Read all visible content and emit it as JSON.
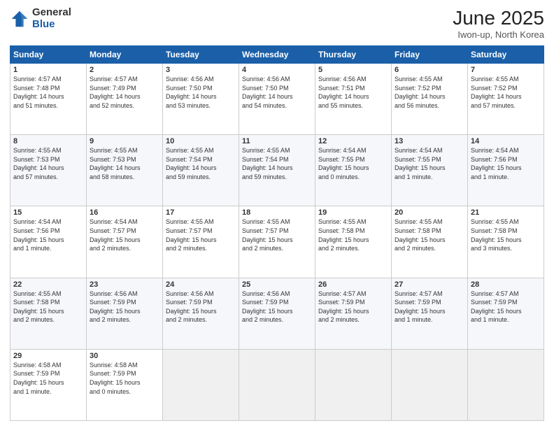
{
  "logo": {
    "general": "General",
    "blue": "Blue"
  },
  "title": {
    "month": "June 2025",
    "location": "Iwon-up, North Korea"
  },
  "weekdays": [
    "Sunday",
    "Monday",
    "Tuesday",
    "Wednesday",
    "Thursday",
    "Friday",
    "Saturday"
  ],
  "weeks": [
    [
      {
        "day": "1",
        "info": "Sunrise: 4:57 AM\nSunset: 7:48 PM\nDaylight: 14 hours\nand 51 minutes."
      },
      {
        "day": "2",
        "info": "Sunrise: 4:57 AM\nSunset: 7:49 PM\nDaylight: 14 hours\nand 52 minutes."
      },
      {
        "day": "3",
        "info": "Sunrise: 4:56 AM\nSunset: 7:50 PM\nDaylight: 14 hours\nand 53 minutes."
      },
      {
        "day": "4",
        "info": "Sunrise: 4:56 AM\nSunset: 7:50 PM\nDaylight: 14 hours\nand 54 minutes."
      },
      {
        "day": "5",
        "info": "Sunrise: 4:56 AM\nSunset: 7:51 PM\nDaylight: 14 hours\nand 55 minutes."
      },
      {
        "day": "6",
        "info": "Sunrise: 4:55 AM\nSunset: 7:52 PM\nDaylight: 14 hours\nand 56 minutes."
      },
      {
        "day": "7",
        "info": "Sunrise: 4:55 AM\nSunset: 7:52 PM\nDaylight: 14 hours\nand 57 minutes."
      }
    ],
    [
      {
        "day": "8",
        "info": "Sunrise: 4:55 AM\nSunset: 7:53 PM\nDaylight: 14 hours\nand 57 minutes."
      },
      {
        "day": "9",
        "info": "Sunrise: 4:55 AM\nSunset: 7:53 PM\nDaylight: 14 hours\nand 58 minutes."
      },
      {
        "day": "10",
        "info": "Sunrise: 4:55 AM\nSunset: 7:54 PM\nDaylight: 14 hours\nand 59 minutes."
      },
      {
        "day": "11",
        "info": "Sunrise: 4:55 AM\nSunset: 7:54 PM\nDaylight: 14 hours\nand 59 minutes."
      },
      {
        "day": "12",
        "info": "Sunrise: 4:54 AM\nSunset: 7:55 PM\nDaylight: 15 hours\nand 0 minutes."
      },
      {
        "day": "13",
        "info": "Sunrise: 4:54 AM\nSunset: 7:55 PM\nDaylight: 15 hours\nand 1 minute."
      },
      {
        "day": "14",
        "info": "Sunrise: 4:54 AM\nSunset: 7:56 PM\nDaylight: 15 hours\nand 1 minute."
      }
    ],
    [
      {
        "day": "15",
        "info": "Sunrise: 4:54 AM\nSunset: 7:56 PM\nDaylight: 15 hours\nand 1 minute."
      },
      {
        "day": "16",
        "info": "Sunrise: 4:54 AM\nSunset: 7:57 PM\nDaylight: 15 hours\nand 2 minutes."
      },
      {
        "day": "17",
        "info": "Sunrise: 4:55 AM\nSunset: 7:57 PM\nDaylight: 15 hours\nand 2 minutes."
      },
      {
        "day": "18",
        "info": "Sunrise: 4:55 AM\nSunset: 7:57 PM\nDaylight: 15 hours\nand 2 minutes."
      },
      {
        "day": "19",
        "info": "Sunrise: 4:55 AM\nSunset: 7:58 PM\nDaylight: 15 hours\nand 2 minutes."
      },
      {
        "day": "20",
        "info": "Sunrise: 4:55 AM\nSunset: 7:58 PM\nDaylight: 15 hours\nand 2 minutes."
      },
      {
        "day": "21",
        "info": "Sunrise: 4:55 AM\nSunset: 7:58 PM\nDaylight: 15 hours\nand 3 minutes."
      }
    ],
    [
      {
        "day": "22",
        "info": "Sunrise: 4:55 AM\nSunset: 7:58 PM\nDaylight: 15 hours\nand 2 minutes."
      },
      {
        "day": "23",
        "info": "Sunrise: 4:56 AM\nSunset: 7:59 PM\nDaylight: 15 hours\nand 2 minutes."
      },
      {
        "day": "24",
        "info": "Sunrise: 4:56 AM\nSunset: 7:59 PM\nDaylight: 15 hours\nand 2 minutes."
      },
      {
        "day": "25",
        "info": "Sunrise: 4:56 AM\nSunset: 7:59 PM\nDaylight: 15 hours\nand 2 minutes."
      },
      {
        "day": "26",
        "info": "Sunrise: 4:57 AM\nSunset: 7:59 PM\nDaylight: 15 hours\nand 2 minutes."
      },
      {
        "day": "27",
        "info": "Sunrise: 4:57 AM\nSunset: 7:59 PM\nDaylight: 15 hours\nand 1 minute."
      },
      {
        "day": "28",
        "info": "Sunrise: 4:57 AM\nSunset: 7:59 PM\nDaylight: 15 hours\nand 1 minute."
      }
    ],
    [
      {
        "day": "29",
        "info": "Sunrise: 4:58 AM\nSunset: 7:59 PM\nDaylight: 15 hours\nand 1 minute."
      },
      {
        "day": "30",
        "info": "Sunrise: 4:58 AM\nSunset: 7:59 PM\nDaylight: 15 hours\nand 0 minutes."
      },
      {
        "day": "",
        "info": ""
      },
      {
        "day": "",
        "info": ""
      },
      {
        "day": "",
        "info": ""
      },
      {
        "day": "",
        "info": ""
      },
      {
        "day": "",
        "info": ""
      }
    ]
  ]
}
